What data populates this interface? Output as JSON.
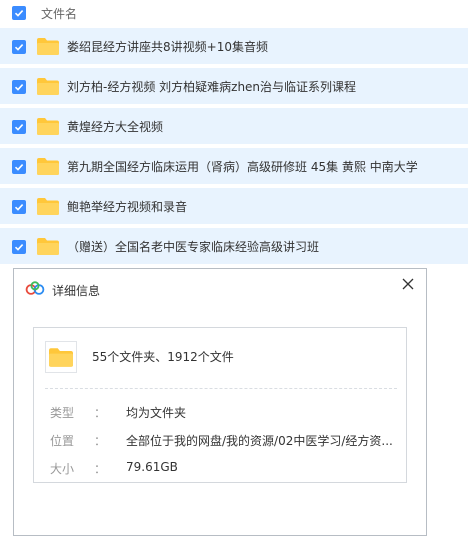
{
  "header": {
    "label": "文件名"
  },
  "files": [
    {
      "name": "娄绍昆经方讲座共8讲视频+10集音频"
    },
    {
      "name": "刘方柏-经方视频 刘方柏疑难病zhen治与临证系列课程"
    },
    {
      "name": "黄煌经方大全视频"
    },
    {
      "name": "第九期全国经方临床运用（肾病）高级研修班 45集 黄熙 中南大学"
    },
    {
      "name": "鲍艳举经方视频和录音"
    },
    {
      "name": "（赠送）全国名老中医专家临床经验高级讲习班"
    }
  ],
  "dialog": {
    "title": "详细信息",
    "summary": "55个文件夹、1912个文件",
    "rows": [
      {
        "key": "类型",
        "colon": "：",
        "value": "均为文件夹"
      },
      {
        "key": "位置",
        "colon": "：",
        "value": "全部位于我的网盘/我的资源/02中医学习/经方资..."
      },
      {
        "key": "大小",
        "colon": "：",
        "value": "79.61GB"
      }
    ]
  },
  "colors": {
    "checkbox": "#3b8cff",
    "row_highlight": "#e8f3fe",
    "folder": "#ffc73a"
  },
  "icons": {
    "checkbox": "check-icon",
    "folder": "folder-icon",
    "cloud": "baidu-cloud-icon",
    "close": "close-icon"
  }
}
